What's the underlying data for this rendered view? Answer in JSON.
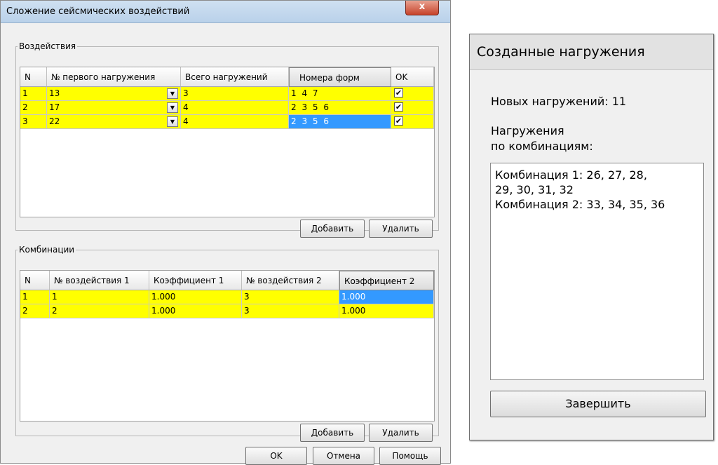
{
  "dialog": {
    "title": "Сложение сейсмических воздействий",
    "close_label": "x",
    "buttons": {
      "ok": "OK",
      "cancel": "Отмена",
      "help": "Помощь"
    }
  },
  "impacts": {
    "legend": "Воздействия",
    "headers": [
      "N",
      "№ первого нагружения",
      "Всего нагружений",
      "Номера форм",
      "OK"
    ],
    "rows": [
      {
        "n": "1",
        "first_load": "13",
        "total": "3",
        "forms": "1 4 7",
        "ok": "✔"
      },
      {
        "n": "2",
        "first_load": "17",
        "total": "4",
        "forms": "2 3 5 6",
        "ok": "✔"
      },
      {
        "n": "3",
        "first_load": "22",
        "total": "4",
        "forms": "2 3 5 6",
        "ok": "✔"
      }
    ],
    "add_label": "Добавить",
    "delete_label": "Удалить"
  },
  "combinations": {
    "legend": "Комбинации",
    "headers": [
      "N",
      "№ воздействия 1",
      "Коэффициент 1",
      "№ воздействия 2",
      "Коэффициент 2"
    ],
    "rows": [
      {
        "n": "1",
        "impact1": "1",
        "coef1": "1.000",
        "impact2": "3",
        "coef2": "1.000"
      },
      {
        "n": "2",
        "impact1": "2",
        "coef1": "1.000",
        "impact2": "3",
        "coef2": "1.000"
      }
    ],
    "add_label": "Добавить",
    "delete_label": "Удалить"
  },
  "created": {
    "title": "Созданные нагружения",
    "new_loads": "Новых нагружений: 11",
    "by_comb_line1": "Нагружения",
    "by_comb_line2": "по комбинациям:",
    "list_line1": "Комбинация 1: 26, 27, 28,",
    "list_line2": "29, 30, 31, 32",
    "list_line3": "Комбинация 2: 33, 34, 35, 36",
    "finish_label": "Завершить"
  },
  "colors": {
    "row_highlight": "#ffff00",
    "selection": "#3399ff"
  }
}
